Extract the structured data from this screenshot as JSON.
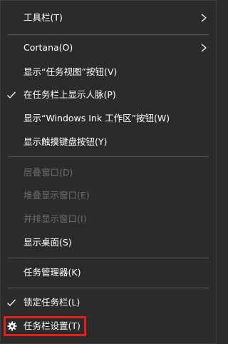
{
  "menu": {
    "items": [
      {
        "label": "工具栏(T)",
        "state": "enabled",
        "submenu": true
      },
      {
        "label": "Cortana(O)",
        "state": "enabled",
        "submenu": true
      },
      {
        "label": "显示“任务视图”按钮(V)",
        "state": "enabled"
      },
      {
        "label": "在任务栏上显示人脉(P)",
        "state": "enabled",
        "checked": true
      },
      {
        "label": "显示“Windows Ink 工作区”按钮(W)",
        "state": "enabled"
      },
      {
        "label": "显示触摸键盘按钮(Y)",
        "state": "enabled"
      },
      {
        "label": "层叠窗口(D)",
        "state": "disabled"
      },
      {
        "label": "堆叠显示窗口(E)",
        "state": "disabled"
      },
      {
        "label": "并排显示窗口(I)",
        "state": "disabled"
      },
      {
        "label": "显示桌面(S)",
        "state": "enabled"
      },
      {
        "label": "任务管理器(K)",
        "state": "enabled"
      },
      {
        "label": "锁定任务栏(L)",
        "state": "enabled",
        "checked": true
      },
      {
        "label": "任务栏设置(T)",
        "state": "enabled",
        "icon": "gear-icon",
        "highlighted": true
      }
    ]
  },
  "colors": {
    "background": "#2b2b2b",
    "text": "#ffffff",
    "disabled_text": "#6d6d6d",
    "separator": "#575757",
    "highlight_border": "#e51d1d"
  }
}
